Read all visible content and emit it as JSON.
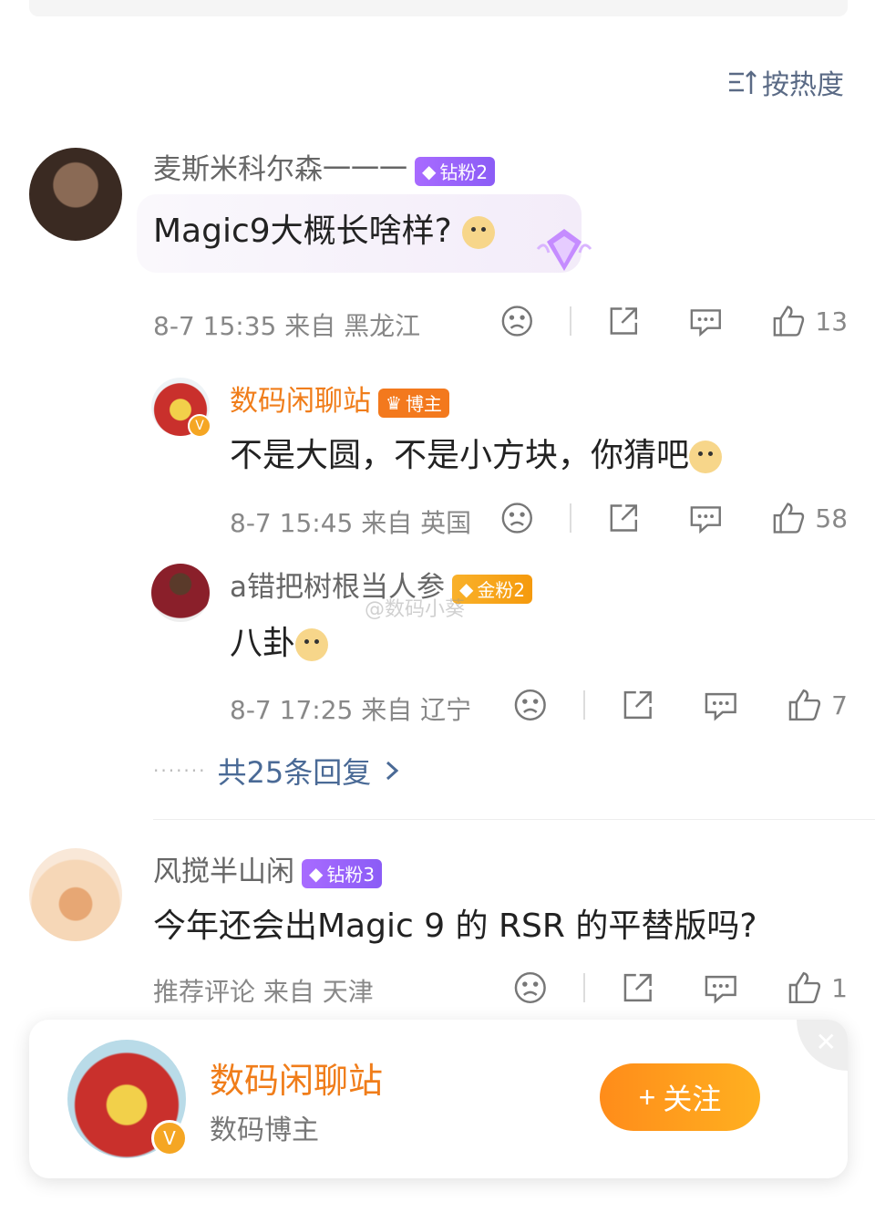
{
  "sort_label": "按热度",
  "comments": [
    {
      "name": "麦斯米科尔森一一一",
      "badge": "钻粉2",
      "text": "Magic9大概长啥样?",
      "meta": "8-7 15:35 来自 黑龙江",
      "likes": "13"
    },
    {
      "name": "风搅半山闲",
      "badge": "钻粉3",
      "text": "今年还会出Magic 9 的 RSR 的平替版吗?",
      "meta": "推荐评论 来自 天津",
      "likes": "1"
    }
  ],
  "replies": [
    {
      "name": "数码闲聊站",
      "badge": "博主",
      "text": "不是大圆，不是小方块，你猜吧",
      "meta": "8-7 15:45 来自 英国",
      "likes": "58"
    },
    {
      "name": "a错把树根当人参",
      "badge": "金粉2",
      "text": "八卦",
      "meta": "8-7 17:25 来自 辽宁",
      "likes": "7"
    }
  ],
  "more_replies": "共25条回复",
  "watermark": "@数码小葵",
  "follow_card": {
    "name": "数码闲聊站",
    "subtitle": "数码博主",
    "button": "关注"
  },
  "colors": {
    "accent": "#f07d1a",
    "link": "#4a6a96",
    "badge_purple": "#8b5cf6",
    "badge_gold": "#f59a0d"
  }
}
